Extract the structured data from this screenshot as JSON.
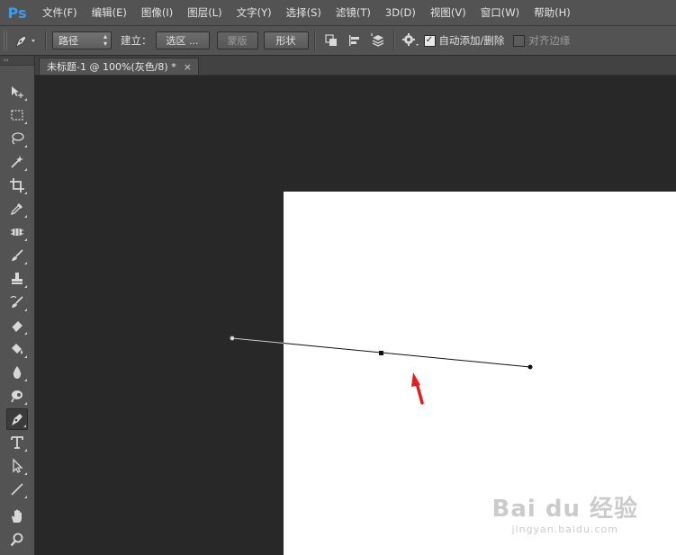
{
  "app": {
    "logo": "Ps"
  },
  "menu": [
    "文件(F)",
    "编辑(E)",
    "图像(I)",
    "图层(L)",
    "文字(Y)",
    "选择(S)",
    "滤镜(T)",
    "3D(D)",
    "视图(V)",
    "窗口(W)",
    "帮助(H)"
  ],
  "options": {
    "tool_icon": "pen-icon",
    "mode_select": "路径",
    "create_label": "建立：",
    "selection_button": "选区 ...",
    "mask_button": "蒙版",
    "shape_button": "形状",
    "auto_add_delete": {
      "label": "自动添加/删除",
      "checked": true
    },
    "align_edges": {
      "label": "对齐边缘",
      "checked": false
    }
  },
  "tabs": [
    {
      "title": "未标题-1 @ 100%(灰色/8) *",
      "close": "×"
    }
  ],
  "toolbar": {
    "header": "››",
    "tools": [
      "move-tool-icon",
      "marquee-tool-icon",
      "lasso-tool-icon",
      "magic-wand-icon",
      "crop-tool-icon",
      "eyedropper-icon",
      "healing-brush-icon",
      "brush-tool-icon",
      "stamp-tool-icon",
      "history-brush-icon",
      "eraser-tool-icon",
      "paint-bucket-icon",
      "blur-tool-icon",
      "dodge-tool-icon",
      "pen-tool-icon",
      "type-tool-icon",
      "path-selection-icon",
      "line-tool-icon",
      "hand-tool-icon",
      "zoom-tool-icon"
    ],
    "active": "pen-tool-icon"
  },
  "watermark": {
    "main": "Bai du 经验",
    "sub": "jingyan.baidu.com"
  },
  "colors": {
    "ui_panel": "#535353",
    "canvas_bg": "#282828",
    "document": "#ffffff",
    "arrow": "#e02020",
    "ps_blue": "#3f9bea"
  }
}
